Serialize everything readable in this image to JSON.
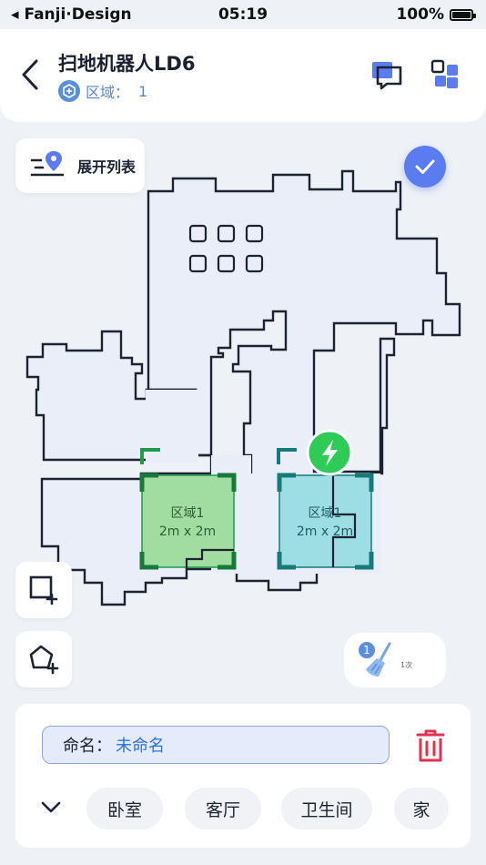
{
  "status_bar": {
    "carrier": "Fanji·Design",
    "time": "05:19",
    "battery": "100%"
  },
  "header": {
    "title": "扫地机器人LD6",
    "zone_label": "区域：",
    "zone_value": "1"
  },
  "map": {
    "expand_list_label": "展开列表",
    "zones": [
      {
        "name": "区域1",
        "size": "2m x 2m",
        "color": "#7fd67f"
      },
      {
        "name": "区域1",
        "size": "2m x 2m",
        "color": "#8fd9e0"
      }
    ],
    "clean_times": "1次",
    "clean_badge": "1"
  },
  "panel": {
    "name_label": "命名：",
    "name_value": "未命名",
    "room_chips": [
      "卧室",
      "客厅",
      "卫生间",
      "家"
    ]
  },
  "colors": {
    "accent": "#5b7cf0",
    "danger": "#e0324f",
    "charge": "#2ecc57",
    "outline": "#1c2333"
  }
}
